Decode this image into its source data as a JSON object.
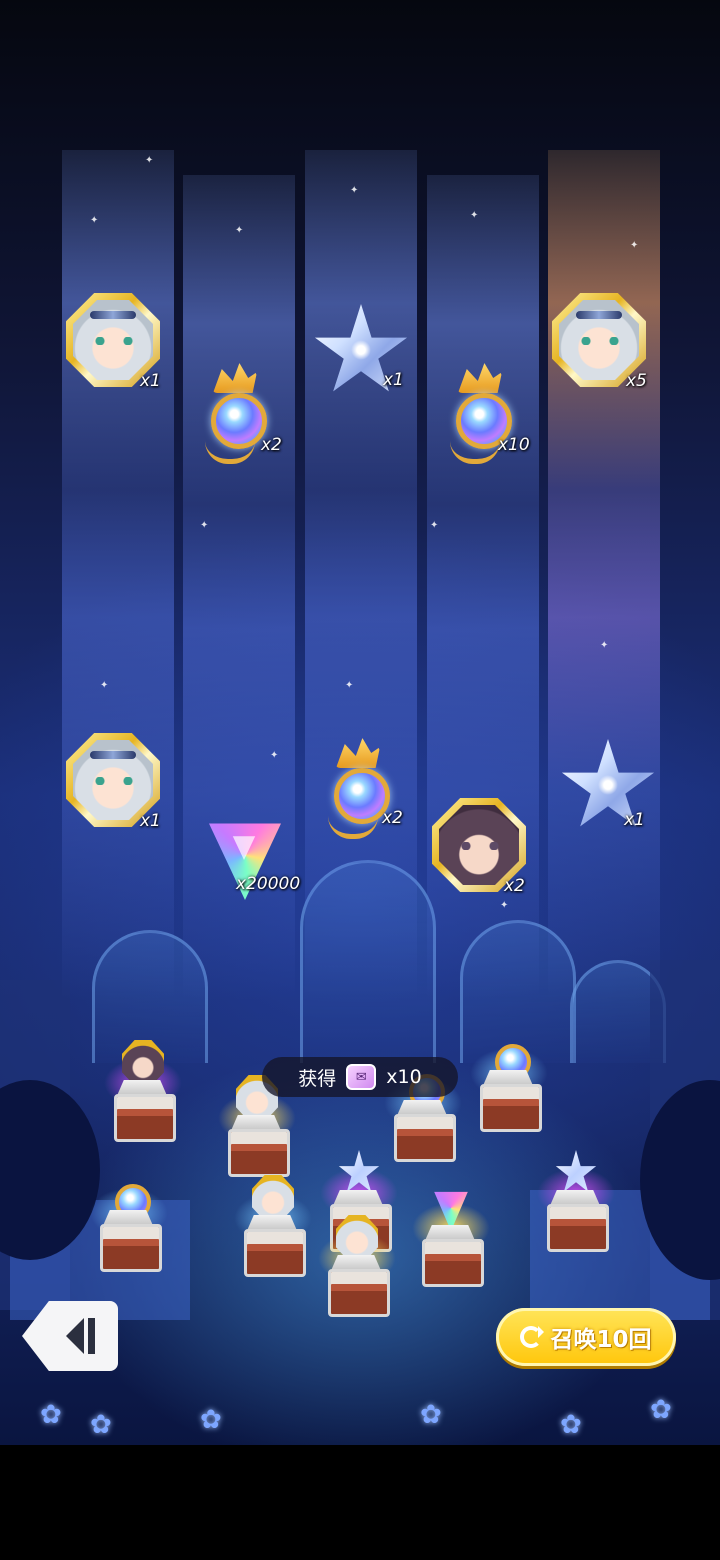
{
  "rewards": [
    {
      "type": "portrait-silver-hair",
      "count": "x1"
    },
    {
      "type": "amulet",
      "count": "x2"
    },
    {
      "type": "star-crystal",
      "count": "x1"
    },
    {
      "type": "amulet",
      "count": "x10"
    },
    {
      "type": "portrait-silver-hair",
      "count": "x5"
    },
    {
      "type": "portrait-silver-hair",
      "count": "x1"
    },
    {
      "type": "prism-gem",
      "count": "x20000"
    },
    {
      "type": "amulet",
      "count": "x2"
    },
    {
      "type": "portrait-dark-hair",
      "count": "x2"
    },
    {
      "type": "star-crystal",
      "count": "x1"
    }
  ],
  "obtained": {
    "label": "获得",
    "icon": "summon-ticket-icon",
    "quantity": "x10"
  },
  "actions": {
    "summon_again_label": "召唤10回",
    "back_icon": "back-arrow-icon",
    "refresh_icon": "refresh-icon"
  },
  "colors": {
    "summon_button": "#ffc60a",
    "background": "#1b2f7a",
    "reward_frame_gold": "#e6b422"
  }
}
